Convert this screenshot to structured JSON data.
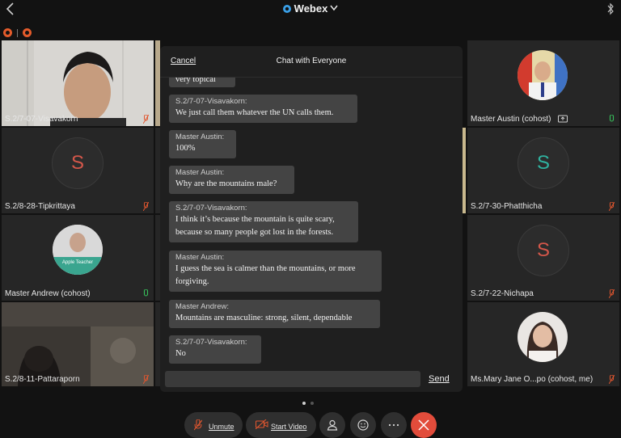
{
  "app": {
    "title": "Webex"
  },
  "participants": {
    "p1": {
      "name": "S.2/7-07-Visavakorn"
    },
    "p2": {
      "name": "S.2/8-28-Tipkrittaya",
      "initial": "S"
    },
    "p3": {
      "name": "Master Andrew (cohost)",
      "badge": "Apple Teacher"
    },
    "p4": {
      "name": "S.2/8-11-Pattaraporn"
    },
    "p5": {
      "name": "Master Austin (cohost)"
    },
    "p6": {
      "name": "S.2/7-30-Phatthicha",
      "initial": "S"
    },
    "p7": {
      "name": "S.2/7-22-Nichapa",
      "initial": "S"
    },
    "p8": {
      "name": "Ms.Mary Jane O...po (cohost, me)"
    }
  },
  "chat": {
    "cancel_label": "Cancel",
    "title": "Chat with Everyone",
    "messages": [
      {
        "text": "very topical"
      },
      {
        "sender": "S.2/7-07-Visavakorn:",
        "text": "We just call them whatever the UN calls them."
      },
      {
        "sender": "Master Austin:",
        "text": "100%"
      },
      {
        "sender": "Master Austin:",
        "text": "Why are the mountains male?"
      },
      {
        "sender": "S.2/7-07-Visavakorn:",
        "text_1": "I think it’s because the mountain is quite scary,",
        "text_2": "because so many people got lost in the forests."
      },
      {
        "sender": "Master Austin:",
        "text_1": "I guess the sea is calmer than the mountains, or more",
        "text_2": "forgiving."
      },
      {
        "sender": "Master Andrew:",
        "text": "Mountains are masculine:  strong, silent, dependable"
      },
      {
        "sender": "S.2/7-07-Visavakorn:",
        "text": "No"
      }
    ],
    "input_value": "",
    "send_label": "Send"
  },
  "controls": {
    "unmute_label": "Unmute",
    "start_video_label": "Start Video"
  },
  "colors": {
    "initial_red": "#d4574a",
    "initial_teal": "#2fb3a0",
    "end_call": "#e24c3b",
    "mic_muted": "#e0562f",
    "mic_active": "#38c15c"
  }
}
